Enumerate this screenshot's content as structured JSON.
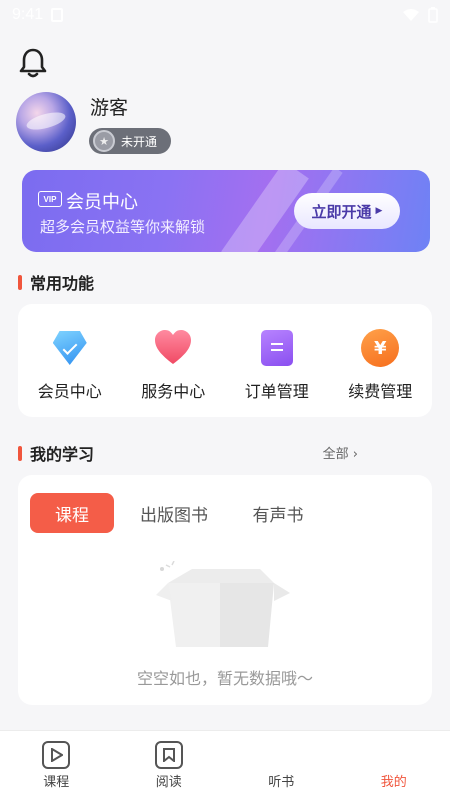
{
  "status_bar": {
    "time": "9:41"
  },
  "profile": {
    "name": "游客",
    "member_status": "未开通"
  },
  "vip": {
    "tag": "VIP",
    "title": "会员中心",
    "subtitle": "超多会员权益等你来解锁",
    "button": "立即开通"
  },
  "common": {
    "title": "常用功能",
    "items": [
      {
        "label": "会员中心",
        "icon": "diamond-icon"
      },
      {
        "label": "服务中心",
        "icon": "heart-icon"
      },
      {
        "label": "订单管理",
        "icon": "order-icon"
      },
      {
        "label": "续费管理",
        "icon": "yen-icon"
      }
    ]
  },
  "study": {
    "title": "我的学习",
    "see_all": "全部",
    "tabs": [
      "课程",
      "出版图书",
      "有声书"
    ],
    "empty_text": "空空如也，暂无数据哦～"
  },
  "tab_bar": {
    "items": [
      "课程",
      "阅读",
      "听书",
      "我的"
    ],
    "active": "我的"
  },
  "colors": {
    "accent": "#f0553c",
    "vip": "#8a72f3"
  }
}
